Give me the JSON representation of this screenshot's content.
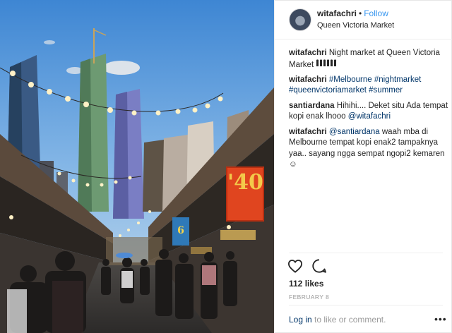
{
  "post": {
    "username": "witafachri",
    "dot": "•",
    "follow_label": "Follow",
    "location": "Queen Victoria Market"
  },
  "photo": {
    "sign_large_text": "'40",
    "sign_small_text": "6"
  },
  "comments": [
    {
      "user": "witafachri",
      "text": "Night market at Queen Victoria Market",
      "hashtags": [],
      "trailing_emoji": "crowd-emoji"
    },
    {
      "user": "witafachri",
      "text": "",
      "hashtags": [
        "#Melbourne",
        "#nightmarket",
        "#queenvictoriamarket",
        "#summer"
      ]
    },
    {
      "user": "santiardana",
      "text": "Hihihi.... Deket situ Ada tempat kopi enak lhooo",
      "mention": "@witafachri"
    },
    {
      "user": "witafachri",
      "mention": "@santiardana",
      "text": "waah mba di Melbourne tempat kopi enak2 tampaknya yaa.. sayang ngga sempat ngopi2 kemaren ☺"
    }
  ],
  "engagement": {
    "likes": "112 likes",
    "date": "FEBRUARY 8"
  },
  "login": {
    "link_text": "Log in",
    "suffix": "to like or comment.",
    "more": "•••"
  },
  "colors": {
    "link_blue": "#3897f0",
    "hashtag_navy": "#003569",
    "muted_gray": "#999999"
  },
  "icons": [
    "heart-icon",
    "comment-icon",
    "more-options-icon"
  ]
}
